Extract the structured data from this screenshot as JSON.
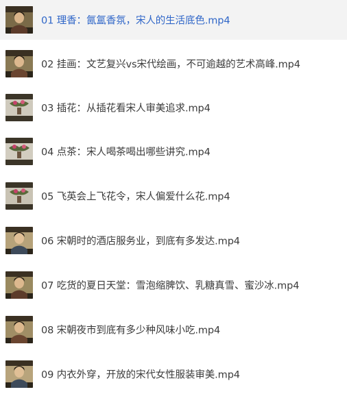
{
  "files": [
    {
      "label": "01 理香：氤氲香氛，宋人的生活底色.mp4",
      "selected": true,
      "thumb": "woman-portrait"
    },
    {
      "label": "02 挂画：文艺复兴vs宋代绘画，不可逾越的艺术高峰.mp4",
      "selected": false,
      "thumb": "woman-portrait"
    },
    {
      "label": "03 插花：从插花看宋人审美追求.mp4",
      "selected": false,
      "thumb": "flower-arrangement"
    },
    {
      "label": "04 点茶：宋人喝茶喝出哪些讲究.mp4",
      "selected": false,
      "thumb": "flower-arrangement"
    },
    {
      "label": "05 飞英会上飞花令，宋人偏爱什么花.mp4",
      "selected": false,
      "thumb": "flower-arrangement"
    },
    {
      "label": "06 宋朝时的酒店服务业，到底有多发达.mp4",
      "selected": false,
      "thumb": "woman-portrait"
    },
    {
      "label": "07 吃货的夏日天堂：雪泡缩脾饮、乳糖真雪、蜜沙冰.mp4",
      "selected": false,
      "thumb": "woman-portrait"
    },
    {
      "label": "08 宋朝夜市到底有多少种风味小吃.mp4",
      "selected": false,
      "thumb": "woman-portrait"
    },
    {
      "label": "09 内衣外穿，开放的宋代女性服装审美.mp4",
      "selected": false,
      "thumb": "woman-portrait"
    }
  ]
}
